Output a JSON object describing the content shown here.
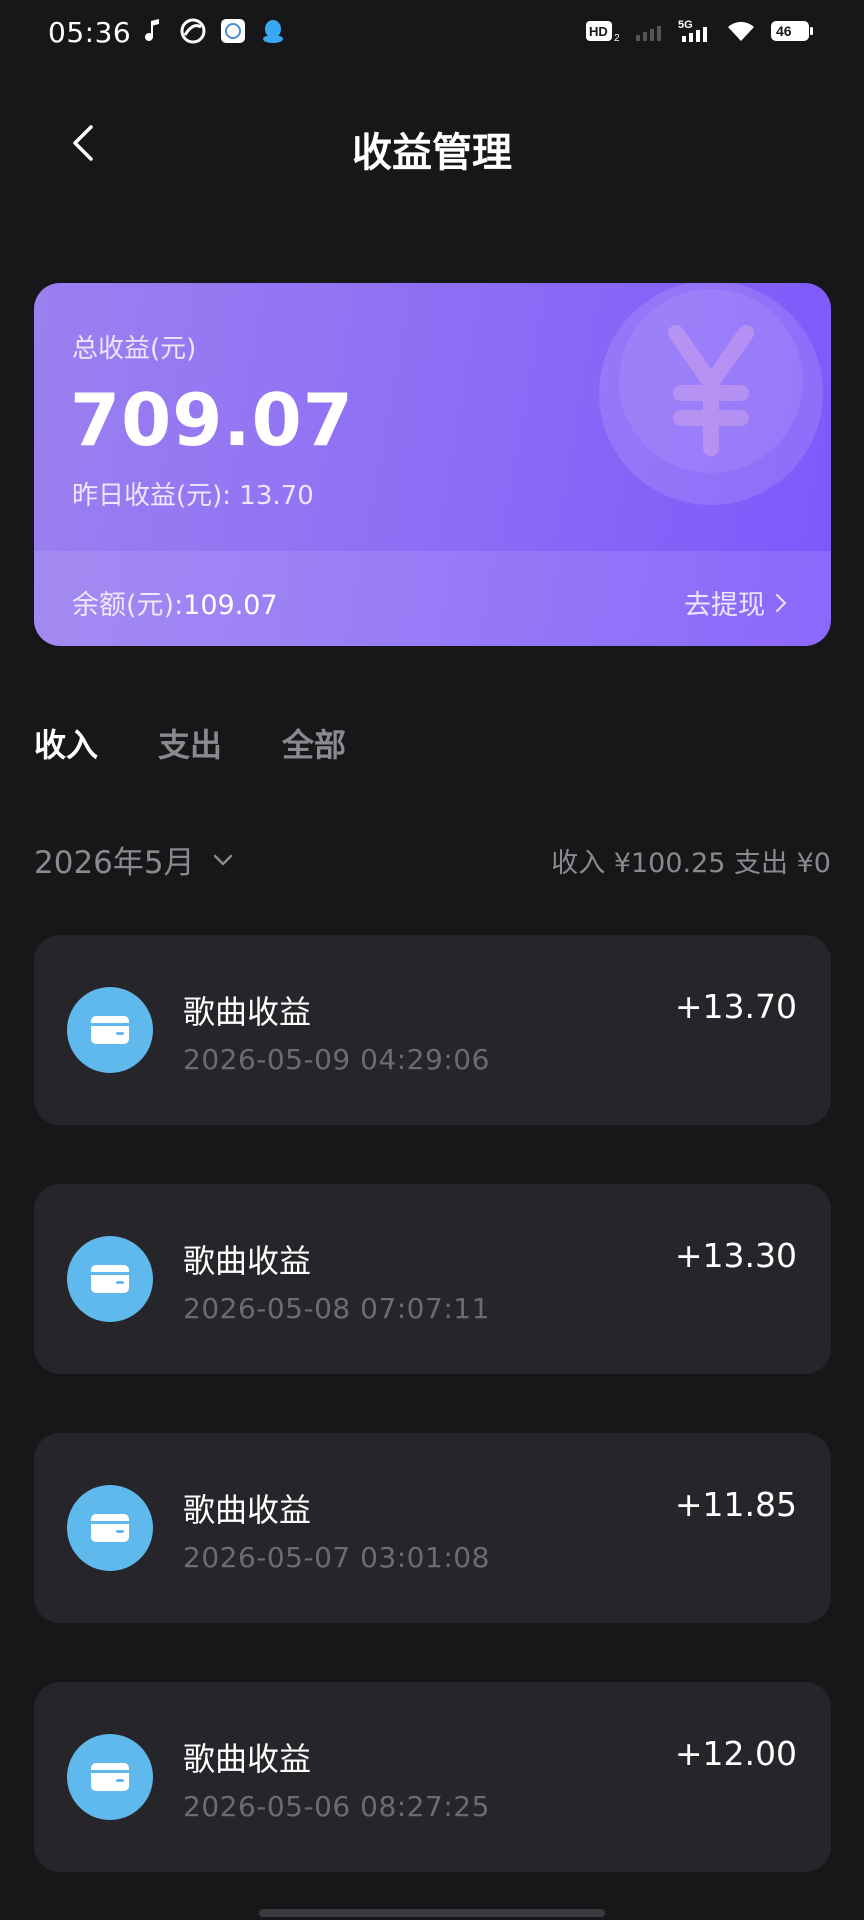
{
  "status_bar": {
    "time": "05:36",
    "hd_label": "HD",
    "network_label": "5G",
    "battery": "46"
  },
  "header": {
    "title": "收益管理",
    "back_icon": "chevron-left-icon"
  },
  "card": {
    "total_label": "总收益(元)",
    "total_value": "709.07",
    "yesterday_label": "昨日收益(元): 13.70",
    "balance_label": "余额(元):",
    "balance_value": "109.07",
    "withdraw_label": "去提现",
    "gradient_start": "#9b80f0",
    "gradient_end": "#7e57fb"
  },
  "tabs": [
    {
      "label": "收入",
      "active": true
    },
    {
      "label": "支出",
      "active": false
    },
    {
      "label": "全部",
      "active": false
    }
  ],
  "month_filter": {
    "label": "2026年5月",
    "summary": "收入 ¥100.25 支出 ¥0"
  },
  "records": [
    {
      "title": "歌曲收益",
      "time": "2026-05-09 04:29:06",
      "amount": "+13.70"
    },
    {
      "title": "歌曲收益",
      "time": "2026-05-08 07:07:11",
      "amount": "+13.30"
    },
    {
      "title": "歌曲收益",
      "time": "2026-05-07 03:01:08",
      "amount": "+11.85"
    },
    {
      "title": "歌曲收益",
      "time": "2026-05-06 08:27:25",
      "amount": "+12.00"
    }
  ],
  "colors": {
    "background": "#17171a",
    "card_item": "#26262a",
    "wallet_icon_bg": "#5fb9ec",
    "muted_text": "#8a8a8e"
  }
}
